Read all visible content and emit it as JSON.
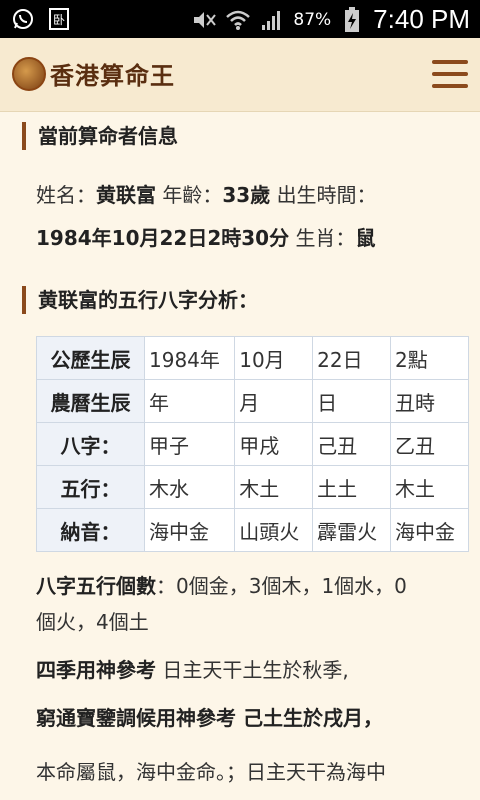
{
  "status_bar": {
    "battery_percent": "87%",
    "time": "7:40 PM"
  },
  "app": {
    "title": "香港算命王"
  },
  "section1": {
    "title": "當前算命者信息",
    "name_label": "姓名：",
    "name": "黄联富",
    "age_label": "年齡：",
    "age": "33歲",
    "birth_label": "出生時間：",
    "birth": "1984年10月22日2時30分",
    "zodiac_label": "生肖：",
    "zodiac": "鼠"
  },
  "section2": {
    "title": "黄联富的五行八字分析："
  },
  "bazi_table": [
    {
      "header": "公歷生辰",
      "cells": [
        "1984年",
        "10月",
        "22日",
        "2點"
      ]
    },
    {
      "header": "農曆生辰",
      "cells": [
        "年",
        "月",
        "日",
        "丑時"
      ]
    },
    {
      "header": "八字：",
      "cells": [
        "甲子",
        "甲戌",
        "己丑",
        "乙丑"
      ]
    },
    {
      "header": "五行：",
      "cells": [
        "木水",
        "木土",
        "土土",
        "木土"
      ]
    },
    {
      "header": "納音：",
      "cells": [
        "海中金",
        "山頭火",
        "霹雷火",
        "海中金"
      ]
    }
  ],
  "wuxing_count": {
    "label": "八字五行個數",
    "line1": "：0個金，3個木，1個水，0",
    "line2": "個火，4個土"
  },
  "season": {
    "label": "四季用神參考",
    "text": " 日主天干土生於秋季,"
  },
  "qiongtong": {
    "label": "窮通寶鑒調候用神參考",
    "text": " 己土生於戌月，"
  },
  "destiny": {
    "text": "本命屬鼠，海中金命。；日主天干為海中"
  }
}
